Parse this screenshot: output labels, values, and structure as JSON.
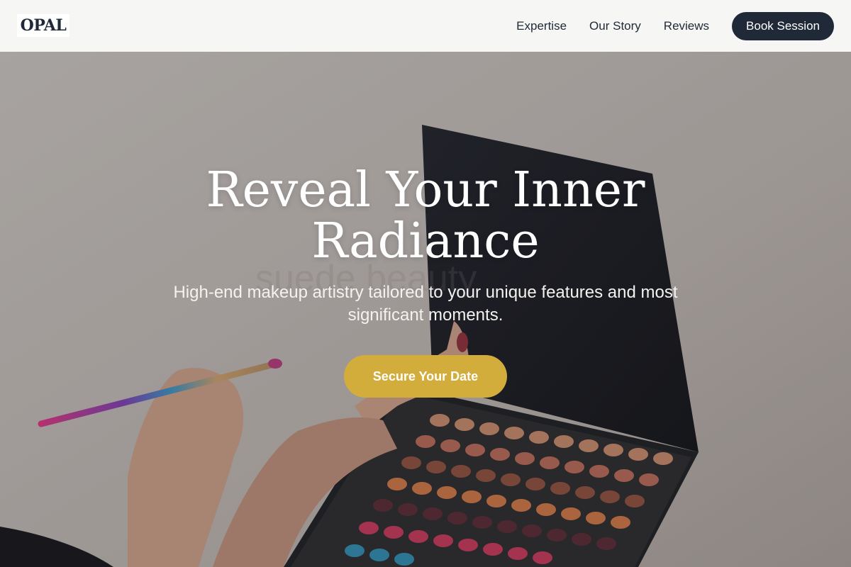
{
  "header": {
    "logo": "OPAL",
    "nav": [
      {
        "label": "Expertise"
      },
      {
        "label": "Our Story"
      },
      {
        "label": "Reviews"
      }
    ],
    "cta_label": "Book Session"
  },
  "hero": {
    "watermark": "suede beauty",
    "title": "Reveal Your Inner Radiance",
    "subtitle": "High-end makeup artistry tailored to your unique features and most significant moments.",
    "cta_label": "Secure Your Date",
    "background": "makeup artist hand holding brush over eyeshadow palette"
  },
  "colors": {
    "header_bg": "#f6f6f5",
    "dark": "#1f2937",
    "gold": "#d3ad3b",
    "hero_bg": "#b7b2ae"
  }
}
